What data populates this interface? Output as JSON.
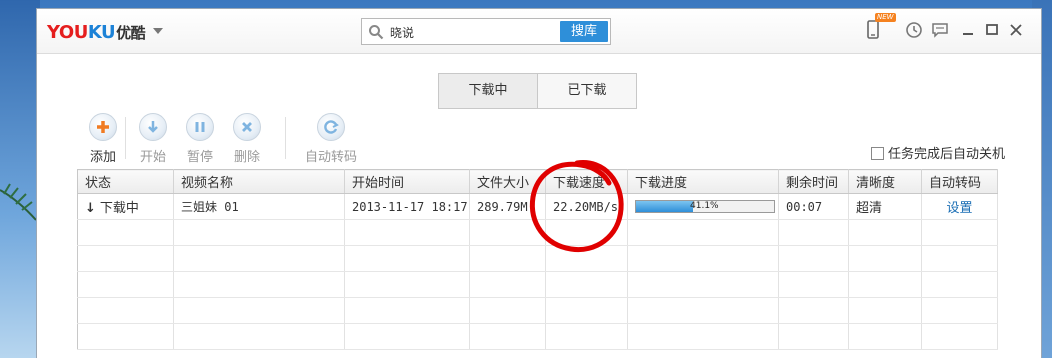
{
  "logo": {
    "brand_you": "YOU",
    "brand_ku": "KU",
    "brand_cn": "优酷"
  },
  "search": {
    "value": "晓说",
    "button_label": "搜库"
  },
  "title_icons": {
    "new_badge": "NEW"
  },
  "tabs": [
    {
      "label": "下载中",
      "active": true
    },
    {
      "label": "已下载",
      "active": false
    }
  ],
  "toolbar": {
    "add": "添加",
    "start": "开始",
    "pause": "暂停",
    "delete": "删除",
    "autotranscode": "自动转码"
  },
  "options": {
    "auto_shutdown_label": "任务完成后自动关机"
  },
  "table": {
    "headers": [
      "状态",
      "视频名称",
      "开始时间",
      "文件大小",
      "下载速度",
      "下载进度",
      "剩余时间",
      "清晰度",
      "自动转码"
    ],
    "rows": [
      {
        "status": "下载中",
        "name": "三姐妹 01",
        "start_time": "2013-11-17 18:17",
        "size": "289.79M",
        "speed": "22.20MB/s",
        "progress_text": "41.1%",
        "progress": 0.411,
        "remaining": "00:07",
        "quality": "超清",
        "transcode_link": "设置"
      }
    ]
  },
  "colors": {
    "accent": "#2e8fd9",
    "brand_red": "#e51e1e",
    "annotation": "#e00000"
  }
}
